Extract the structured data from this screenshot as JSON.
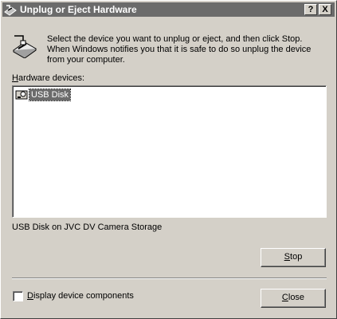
{
  "window": {
    "title": "Unplug or Eject Hardware",
    "help_button": "?",
    "close_button": "X"
  },
  "instructions": "Select the device you want to unplug or eject, and then click Stop. When Windows notifies you that it is safe to do so unplug the device from your computer.",
  "hardware_devices": {
    "label_accel": "H",
    "label_rest": "ardware devices:",
    "items": [
      {
        "label": "USB Disk",
        "icon": "usb-disk-icon",
        "selected": true
      }
    ]
  },
  "device_description": "USB Disk on JVC DV Camera Storage",
  "buttons": {
    "stop_accel": "S",
    "stop_rest": "top",
    "close_accel": "C",
    "close_rest": "lose"
  },
  "display_components": {
    "accel": "D",
    "rest": "isplay device components",
    "checked": false
  },
  "colors": {
    "face": "#d4d0c8",
    "titlebar": "#6b6b6b",
    "selection": "#6b6b6b"
  }
}
